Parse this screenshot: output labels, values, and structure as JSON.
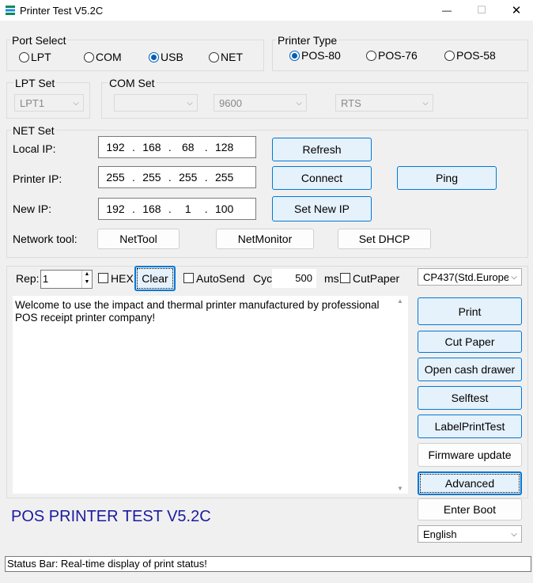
{
  "window": {
    "title": "Printer Test V5.2C",
    "minimize": "—",
    "maximize": "☐",
    "close": "✕"
  },
  "port_select": {
    "legend": "Port Select",
    "options": [
      "LPT",
      "COM",
      "USB",
      "NET"
    ],
    "selected": "USB"
  },
  "printer_type": {
    "legend": "Printer Type",
    "options": [
      "POS-80",
      "POS-76",
      "POS-58"
    ],
    "selected": "POS-80"
  },
  "lpt_set": {
    "legend": "LPT Set",
    "port": "LPT1"
  },
  "com_set": {
    "legend": "COM Set",
    "port": "",
    "baud": "9600",
    "flow": "RTS"
  },
  "net_set": {
    "legend": "NET Set",
    "local_ip_label": "Local IP:",
    "local_ip": [
      "192",
      "168",
      "68",
      "128"
    ],
    "printer_ip_label": "Printer IP:",
    "printer_ip": [
      "255",
      "255",
      "255",
      "255"
    ],
    "new_ip_label": "New IP:",
    "new_ip": [
      "192",
      "168",
      "1",
      "100"
    ],
    "refresh": "Refresh",
    "connect": "Connect",
    "ping": "Ping",
    "set_new_ip": "Set New IP",
    "network_tool_label": "Network tool:",
    "nettool": "NetTool",
    "netmonitor": "NetMonitor",
    "set_dhcp": "Set DHCP"
  },
  "send": {
    "rep_label": "Rep:",
    "rep_value": "1",
    "hex_label": "HEX",
    "clear": "Clear",
    "autosend_label": "AutoSend",
    "cyc_label": "Cyc",
    "cyc_value": "500",
    "ms_label": "ms",
    "cutpaper_label": "CutPaper",
    "codepage": "CP437(Std.Europe",
    "text": "Welcome to use the impact and thermal printer manufactured by professional POS receipt printer company!"
  },
  "actions": {
    "print": "Print",
    "cut_paper": "Cut Paper",
    "open_cash_drawer": "Open cash drawer",
    "selftest": "Selftest",
    "label_print_test": "LabelPrintTest",
    "firmware_update": "Firmware update",
    "advanced": "Advanced",
    "enter_boot": "Enter Boot",
    "language": "English"
  },
  "banner": "POS PRINTER TEST V5.2C",
  "status_bar": "Status Bar: Real-time display of print status!",
  "colors": {
    "accent": "#0078d7",
    "banner": "#1a1aa0",
    "radio": "#005fb8"
  }
}
